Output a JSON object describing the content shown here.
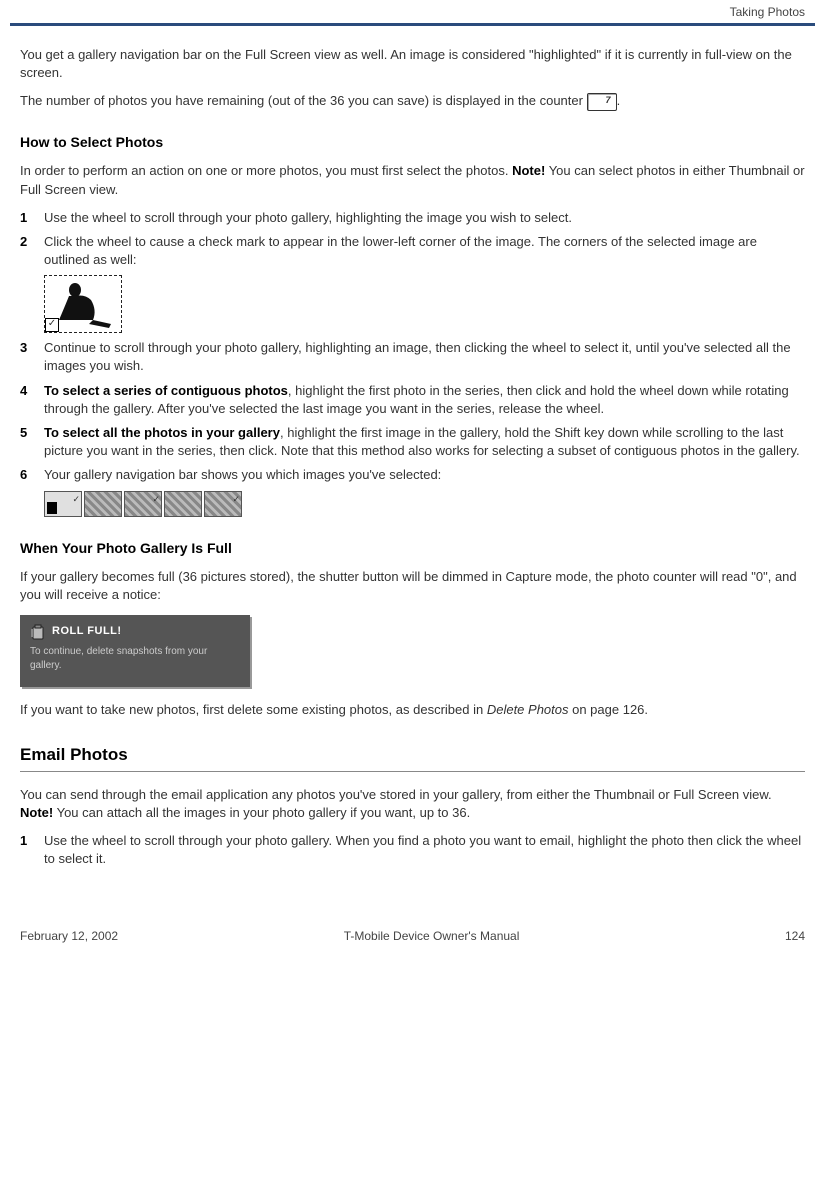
{
  "header": {
    "breadcrumb": "Taking Photos"
  },
  "intro": {
    "p1": "You get a gallery navigation bar on the Full Screen view as well. An image is considered \"highlighted\" if it is currently in full-view on the screen.",
    "p2a": "The number of photos you have remaining (out of the 36 you can save) is displayed in the counter ",
    "p2b": "."
  },
  "select": {
    "title": "How to Select Photos",
    "p1a": "In order to perform an action on one or more photos, you must first select the photos. ",
    "note": "Note!",
    "p1b": " You can select photos in either Thumbnail or Full Screen view.",
    "items": {
      "i1": "Use the wheel to scroll through your photo gallery, highlighting the image you wish to select.",
      "i2": "Click the wheel to cause a check mark to appear in the lower-left corner of the image. The corners of the selected image are outlined as well:",
      "i3": "Continue to scroll through your photo gallery, highlighting an image, then clicking the wheel to select it, until you've selected all the images you wish.",
      "i4b": "To select a series of contiguous photos",
      "i4": ", highlight the first photo in the series, then click and hold the wheel down while rotating through the gallery. After you've selected the last image you want in the series, release the wheel.",
      "i5b": "To select all the photos in your gallery",
      "i5": ", highlight the first image in the gallery, hold the Shift key down while scrolling to the last picture you want in the series, then click. Note that this method also works for selecting a subset of contiguous photos in the gallery.",
      "i6": "Your gallery navigation bar shows you which images you've selected:"
    }
  },
  "full": {
    "title": "When Your Photo Gallery Is Full",
    "p1": "If your gallery becomes full (36 pictures stored), the shutter button will be dimmed in Capture mode, the photo counter will read \"0\", and you will receive a notice:",
    "notice_head": "ROLL FULL!",
    "notice_body": "To continue, delete snapshots from your gallery.",
    "p2a": "If you want to take new photos, first delete some existing photos, as described in ",
    "p2link": "Delete Photos",
    "p2b": " on page 126."
  },
  "email": {
    "title": "Email Photos",
    "p1a": "You can send through the email application any photos you've stored in your gallery, from either the Thumbnail or Full Screen view. ",
    "note": "Note!",
    "p1b": " You can attach all the images in your photo gallery if you want, up to 36.",
    "i1": "Use the wheel to scroll through your photo gallery. When you find a photo you want to email, highlight the photo then click the wheel to select it."
  },
  "footer": {
    "date": "February 12, 2002",
    "manual": "T-Mobile Device Owner's Manual",
    "page": "124"
  }
}
